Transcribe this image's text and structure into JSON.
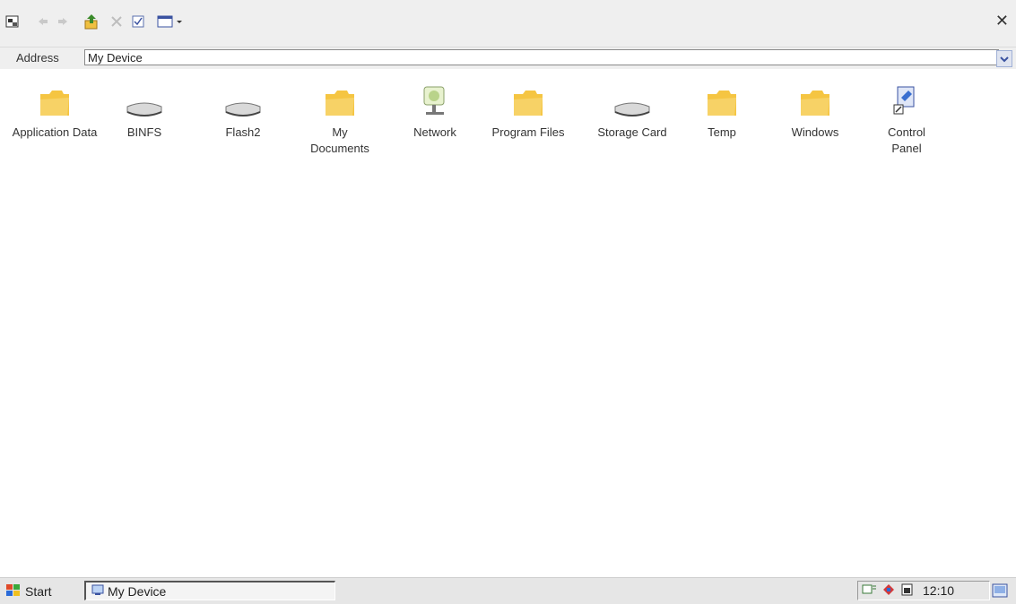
{
  "toolbar": {
    "buttons": [
      "app-menu",
      "back",
      "forward",
      "up-folder",
      "delete",
      "properties",
      "views"
    ]
  },
  "address": {
    "label": "Address",
    "value": "My Device"
  },
  "items": [
    {
      "label": "Application Data",
      "icon": "folder-icon"
    },
    {
      "label": "BINFS",
      "icon": "drive-icon"
    },
    {
      "label": "Flash2",
      "icon": "drive-icon"
    },
    {
      "label": "My Documents",
      "icon": "folder-icon"
    },
    {
      "label": "Network",
      "icon": "network-icon"
    },
    {
      "label": "Program Files",
      "icon": "folder-icon"
    },
    {
      "label": "Storage Card",
      "icon": "drive-icon"
    },
    {
      "label": "Temp",
      "icon": "folder-icon"
    },
    {
      "label": "Windows",
      "icon": "folder-icon"
    },
    {
      "label": "Control Panel",
      "icon": "control-panel-icon"
    }
  ],
  "taskbar": {
    "start_label": "Start",
    "task_label": "My Device",
    "clock": "12:10"
  },
  "colors": {
    "folder": "#f5c542",
    "toolbar_bg": "#efefef",
    "taskbar_bg": "#e6e6e6"
  }
}
